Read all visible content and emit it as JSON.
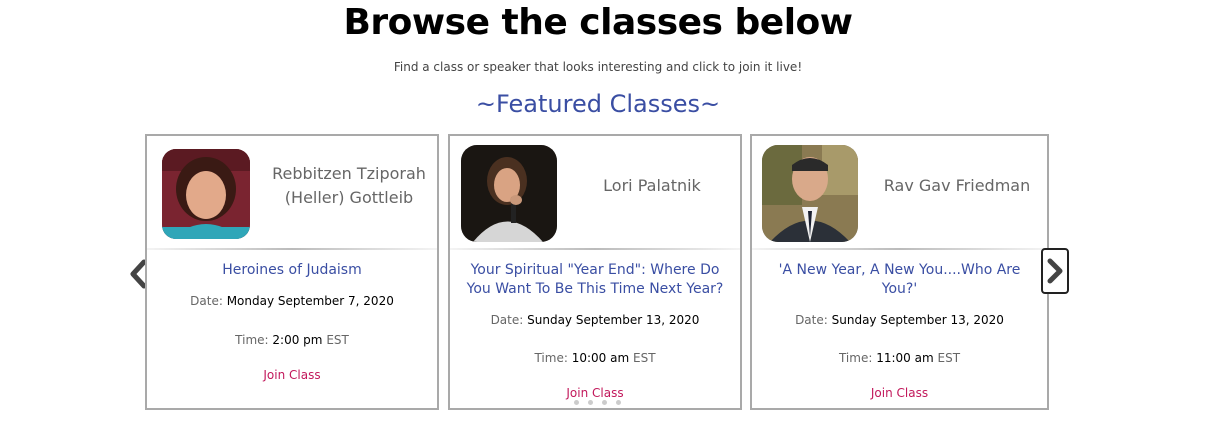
{
  "header": {
    "title": "Browse the classes below",
    "subtitle": "Find a class or speaker that looks interesting and click to join it live!",
    "featured_heading": "~Featured Classes~"
  },
  "cards": [
    {
      "speaker": "Rebbitzen Tziporah (Heller) Gottleib",
      "title": "Heroines of Judaism",
      "date_label": "Date:",
      "date_value": "Monday September 7, 2020",
      "time_label": "Time:",
      "time_value": "2:00 pm",
      "timezone": "EST",
      "join_label": "Join Class"
    },
    {
      "speaker": "Lori Palatnik",
      "title": "Your Spiritual \"Year End\": Where Do You Want To Be This Time Next Year?",
      "date_label": "Date:",
      "date_value": "Sunday September 13, 2020",
      "time_label": "Time:",
      "time_value": "10:00 am",
      "timezone": "EST",
      "join_label": "Join Class"
    },
    {
      "speaker": "Rav Gav Friedman",
      "title": "'A New Year, A New You....Who Are You?'",
      "date_label": "Date:",
      "date_value": "Sunday September 13, 2020",
      "time_label": "Time:",
      "time_value": "11:00 am",
      "timezone": "EST",
      "join_label": "Join Class"
    }
  ],
  "carousel": {
    "prev_icon": "chevron-left-icon",
    "next_icon": "chevron-right-icon",
    "page_dots": 4
  },
  "colors": {
    "accent": "#3a4ea3",
    "join_link": "#c2185b",
    "card_border": "#a9a9a9"
  }
}
